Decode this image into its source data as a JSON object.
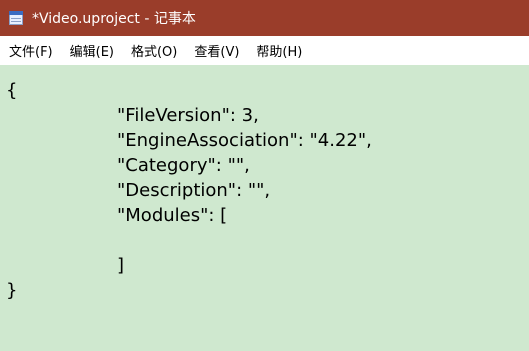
{
  "window": {
    "title": "*Video.uproject - 记事本",
    "icon": "notepad-icon"
  },
  "menu": {
    "items": [
      "文件(F)",
      "编辑(E)",
      "格式(O)",
      "查看(V)",
      "帮助(H)"
    ]
  },
  "editor": {
    "lines": [
      "{",
      "\"FileVersion\": 3,",
      "\"EngineAssociation\": \"4.22\",",
      "\"Category\": \"\",",
      "\"Description\": \"\",",
      "\"Modules\": [",
      "",
      "]",
      "}"
    ]
  },
  "colors": {
    "titlebar": "#9a3d2a",
    "editor_background": "#cfe8cf",
    "menubar": "#ffffff"
  }
}
